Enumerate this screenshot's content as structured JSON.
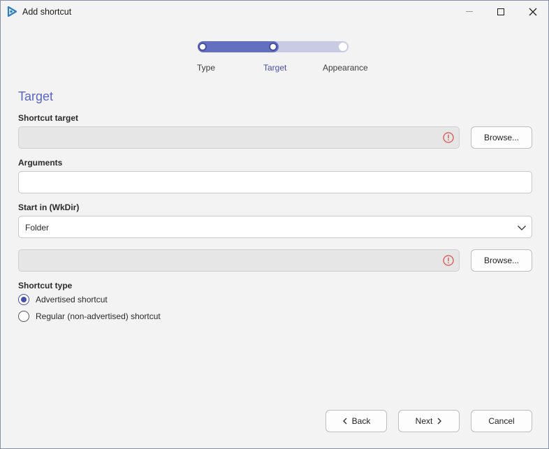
{
  "window": {
    "title": "Add shortcut"
  },
  "stepper": {
    "steps": [
      {
        "label": "Type",
        "state": "done"
      },
      {
        "label": "Target",
        "state": "current"
      },
      {
        "label": "Appearance",
        "state": "pending"
      }
    ]
  },
  "section": {
    "title": "Target"
  },
  "shortcut_target": {
    "label": "Shortcut target",
    "value": "",
    "browse_label": "Browse..."
  },
  "arguments": {
    "label": "Arguments",
    "value": ""
  },
  "start_in": {
    "label": "Start in (WkDir)",
    "selected": "Folder",
    "path_value": "",
    "browse_label": "Browse..."
  },
  "shortcut_type": {
    "label": "Shortcut type",
    "options": [
      {
        "label": "Advertised shortcut",
        "checked": true
      },
      {
        "label": "Regular (non-advertised) shortcut",
        "checked": false
      }
    ]
  },
  "footer": {
    "back_label": "Back",
    "next_label": "Next",
    "cancel_label": "Cancel"
  },
  "colors": {
    "accent": "#5865c4",
    "error": "#d9534f"
  },
  "icons": {
    "app": "app-icon",
    "error": "error-icon",
    "chevron": "chevron-down-icon"
  }
}
